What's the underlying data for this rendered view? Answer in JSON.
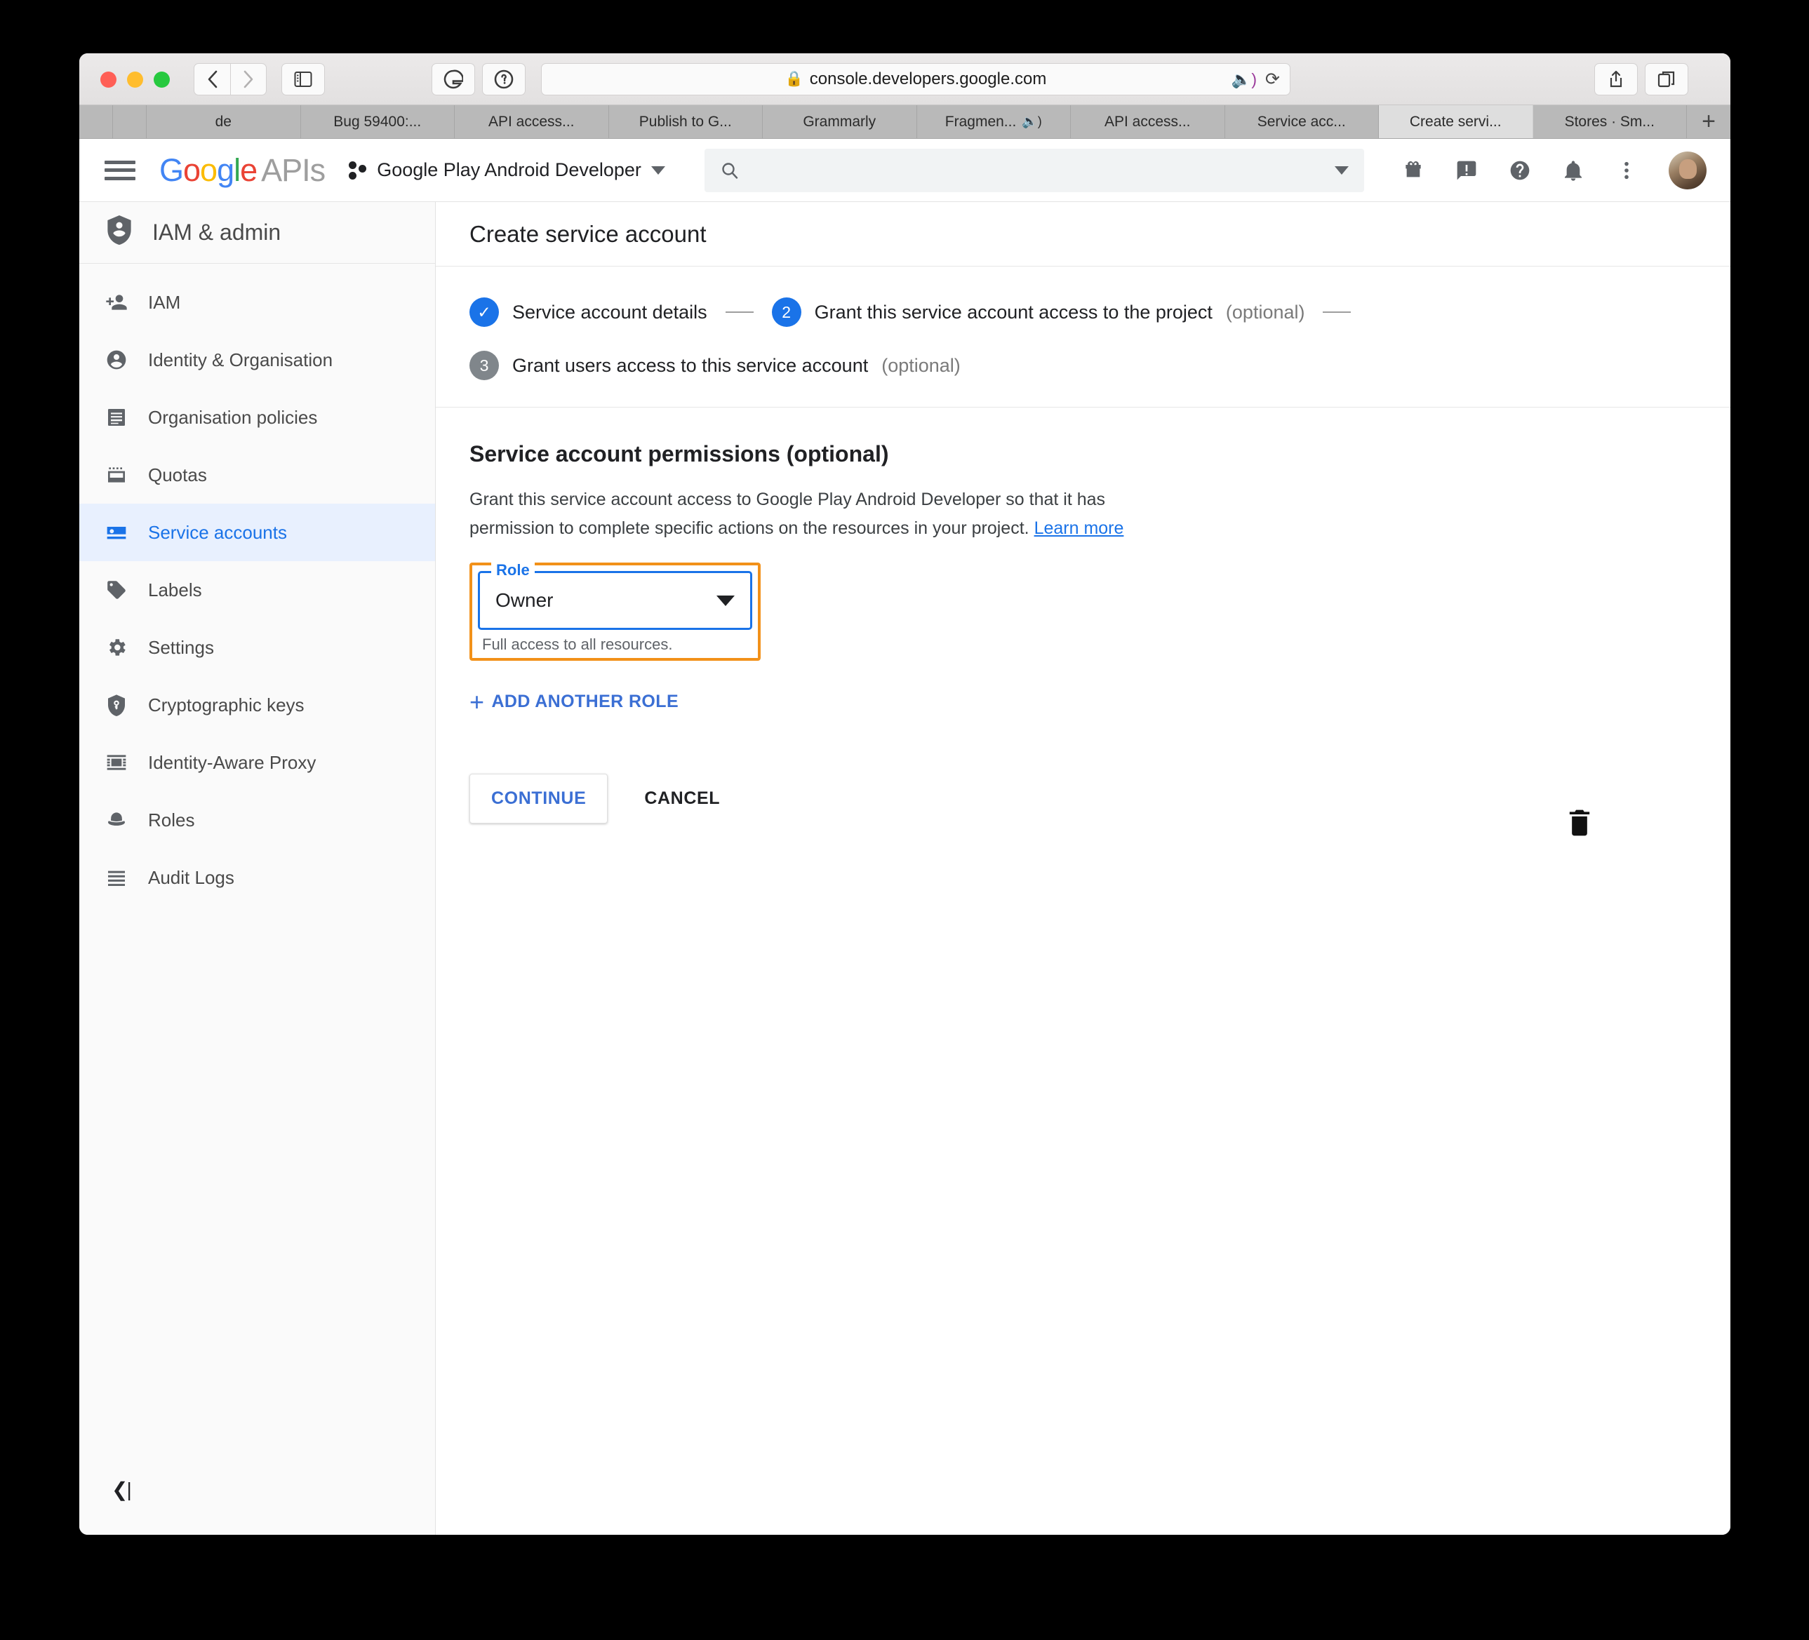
{
  "browser": {
    "url": "console.developers.google.com",
    "lock_icon": "lock-icon",
    "back_icon": "chevron-left-icon",
    "forward_icon": "chevron-right-icon",
    "sidebar_icon": "sidebar-toggle-icon",
    "grammarly_icon": "grammarly-icon",
    "onepassword_icon": "onepassword-icon",
    "share_icon": "share-icon",
    "tab_overview_icon": "tab-overview-icon",
    "sound_icon": "speaker-icon",
    "reload_icon": "reload-icon",
    "new_tab_label": "+",
    "tabs": [
      {
        "label": "",
        "active": false,
        "narrow": true,
        "muted": false
      },
      {
        "label": "",
        "active": false,
        "narrow": true,
        "muted": false
      },
      {
        "label": "de",
        "active": false,
        "narrow": false,
        "muted": false
      },
      {
        "label": "Bug 59400:...",
        "active": false,
        "narrow": false,
        "muted": false
      },
      {
        "label": "API access...",
        "active": false,
        "narrow": false,
        "muted": false
      },
      {
        "label": "Publish to G...",
        "active": false,
        "narrow": false,
        "muted": false
      },
      {
        "label": "Grammarly",
        "active": false,
        "narrow": false,
        "muted": false
      },
      {
        "label": "Fragmen...",
        "active": false,
        "narrow": false,
        "muted": true
      },
      {
        "label": "API access...",
        "active": false,
        "narrow": false,
        "muted": false
      },
      {
        "label": "Service acc...",
        "active": false,
        "narrow": false,
        "muted": false
      },
      {
        "label": "Create servi...",
        "active": true,
        "narrow": false,
        "muted": false
      },
      {
        "label": "Stores · Sm...",
        "active": false,
        "narrow": false,
        "muted": false
      }
    ]
  },
  "header": {
    "menu_icon": "hamburger-menu-icon",
    "logo_google": "Google",
    "logo_apis": "APIs",
    "project_name": "Google Play Android Developer",
    "project_caret_icon": "chevron-down-icon",
    "search": {
      "value": "",
      "placeholder": "",
      "icon": "search-icon",
      "caret_icon": "chevron-down-icon"
    },
    "icons": [
      {
        "name": "gift-icon"
      },
      {
        "name": "feedback-icon"
      },
      {
        "name": "help-icon"
      },
      {
        "name": "notifications-bell-icon"
      },
      {
        "name": "more-vert-icon"
      }
    ],
    "avatar": "user-avatar"
  },
  "sidebar": {
    "title": "IAM & admin",
    "title_icon": "shield-person-icon",
    "collapse_icon": "collapse-sidebar-icon",
    "items": [
      {
        "label": "IAM",
        "icon": "person-add-icon",
        "selected": false
      },
      {
        "label": "Identity & Organisation",
        "icon": "account-circle-icon",
        "selected": false
      },
      {
        "label": "Organisation policies",
        "icon": "policy-list-icon",
        "selected": false
      },
      {
        "label": "Quotas",
        "icon": "quotas-icon",
        "selected": false
      },
      {
        "label": "Service accounts",
        "icon": "key-card-icon",
        "selected": true
      },
      {
        "label": "Labels",
        "icon": "label-tag-icon",
        "selected": false
      },
      {
        "label": "Settings",
        "icon": "gear-icon",
        "selected": false
      },
      {
        "label": "Cryptographic keys",
        "icon": "shield-key-icon",
        "selected": false
      },
      {
        "label": "Identity-Aware Proxy",
        "icon": "iap-icon",
        "selected": false
      },
      {
        "label": "Roles",
        "icon": "hat-icon",
        "selected": false
      },
      {
        "label": "Audit Logs",
        "icon": "list-lines-icon",
        "selected": false
      }
    ]
  },
  "main": {
    "page_title": "Create service account",
    "steps": [
      {
        "num": "✓",
        "state": "done",
        "label": "Service account details",
        "optional": ""
      },
      {
        "num": "2",
        "state": "active",
        "label": "Grant this service account access to the project",
        "optional": "(optional)"
      },
      {
        "num": "3",
        "state": "inactive",
        "label": "Grant users access to this service account",
        "optional": "(optional)"
      }
    ],
    "permissions": {
      "heading": "Service account permissions (optional)",
      "description_1": "Grant this service account access to Google Play Android Developer so that it has",
      "description_2": "permission to complete specific actions on the resources in your project.",
      "learn_more": "Learn more",
      "role_label": "Role",
      "role_value": "Owner",
      "role_hint": "Full access to all resources.",
      "role_dropdown_icon": "chevron-down-icon",
      "delete_icon": "trash-icon",
      "add_role_label": "ADD ANOTHER ROLE",
      "add_role_icon": "plus-icon",
      "highlight_color": "#f29119",
      "focus_color": "#1a73e8"
    },
    "actions": {
      "continue_label": "CONTINUE",
      "cancel_label": "CANCEL"
    }
  }
}
